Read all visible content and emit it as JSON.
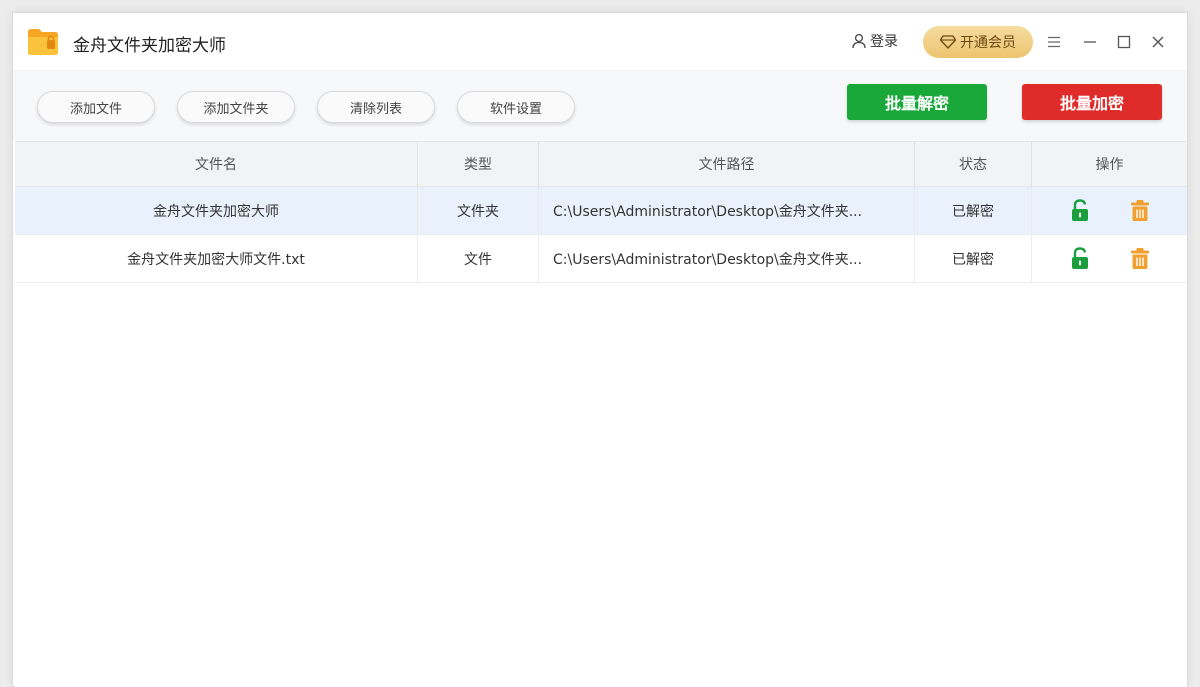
{
  "app": {
    "title": "金舟文件夹加密大师",
    "login_label": "登录",
    "vip_label": "开通会员"
  },
  "toolbar": {
    "add_file": "添加文件",
    "add_folder": "添加文件夹",
    "clear_list": "清除列表",
    "settings": "软件设置",
    "batch_decrypt": "批量解密",
    "batch_encrypt": "批量加密"
  },
  "table": {
    "headers": [
      "文件名",
      "类型",
      "文件路径",
      "状态",
      "操作"
    ],
    "rows": [
      {
        "name": "金舟文件夹加密大师",
        "type": "文件夹",
        "path": "C:\\Users\\Administrator\\Desktop\\金舟文件夹...",
        "status": "已解密",
        "actions": [
          "unlock-icon",
          "trash-icon"
        ]
      },
      {
        "name": "金舟文件夹加密大师文件.txt",
        "type": "文件",
        "path": "C:\\Users\\Administrator\\Desktop\\金舟文件夹...",
        "status": "已解密",
        "actions": [
          "unlock-icon",
          "trash-icon"
        ]
      }
    ]
  },
  "colors": {
    "decrypt_green": "#1aa83a",
    "encrypt_red": "#e02b2b",
    "vip_gold": "#ecc46f",
    "unlock_green": "#1b9e3e",
    "trash_orange": "#f0a030",
    "selected_row": "#e9f2fc"
  }
}
